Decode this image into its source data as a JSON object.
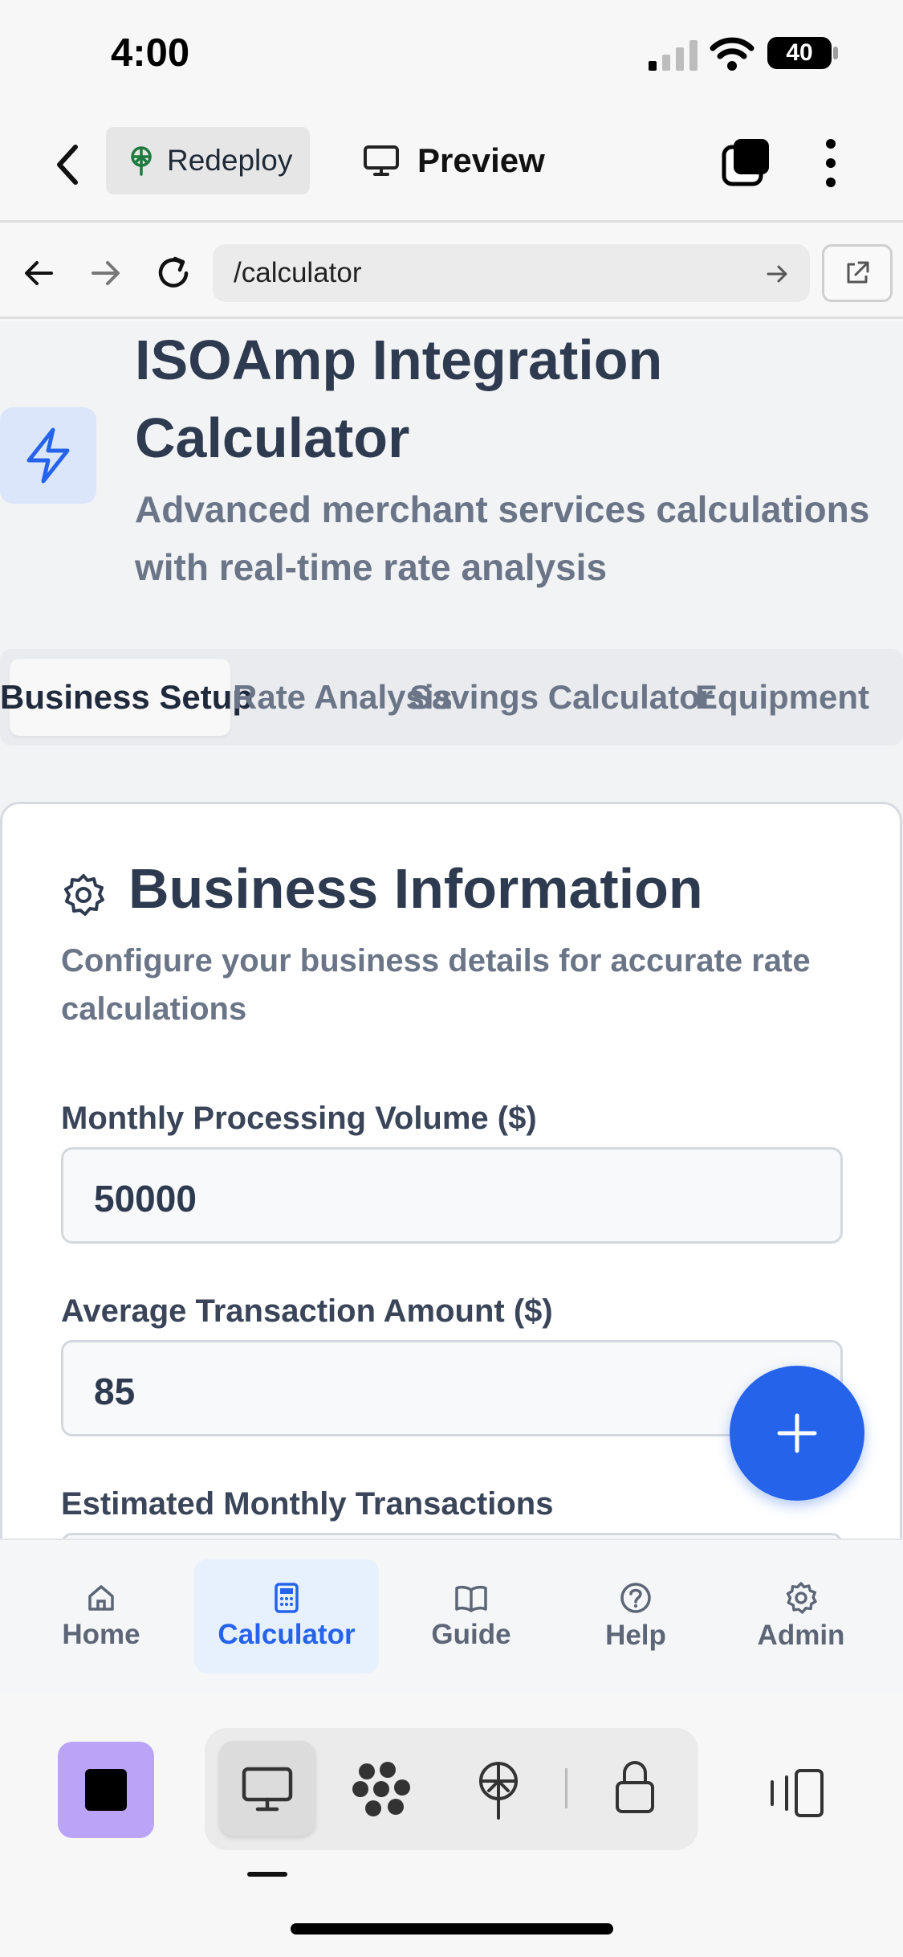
{
  "status_bar": {
    "time": "4:00",
    "battery": "40"
  },
  "top_bar": {
    "redeploy_label": "Redeploy",
    "preview_label": "Preview"
  },
  "url_bar": {
    "url": "/calculator"
  },
  "page": {
    "title": "ISOAmp Integration Calculator",
    "subtitle": "Advanced merchant services calculations with real-time rate analysis"
  },
  "tabs": [
    {
      "label": "Business Setup",
      "active": true
    },
    {
      "label": "Rate Analysis",
      "active": false
    },
    {
      "label": "Savings Calculator",
      "active": false
    },
    {
      "label": "Equipment",
      "active": false
    }
  ],
  "card": {
    "title": "Business Information",
    "description": "Configure your business details for accurate rate calculations",
    "fields": [
      {
        "label": "Monthly Processing Volume ($)",
        "value": "50000"
      },
      {
        "label": "Average Transaction Amount ($)",
        "value": "85"
      },
      {
        "label": "Estimated Monthly Transactions",
        "value": ""
      }
    ]
  },
  "app_nav": [
    {
      "label": "Home",
      "icon": "home-icon",
      "active": false
    },
    {
      "label": "Calculator",
      "icon": "calculator-icon",
      "active": true
    },
    {
      "label": "Guide",
      "icon": "book-icon",
      "active": false
    },
    {
      "label": "Help",
      "icon": "help-circle-icon",
      "active": false
    },
    {
      "label": "Admin",
      "icon": "gear-icon",
      "active": false
    }
  ],
  "colors": {
    "accent": "#2563eb",
    "title": "#2e3a4f",
    "muted": "#6b7588",
    "stop_button": "#b9a4f7"
  }
}
